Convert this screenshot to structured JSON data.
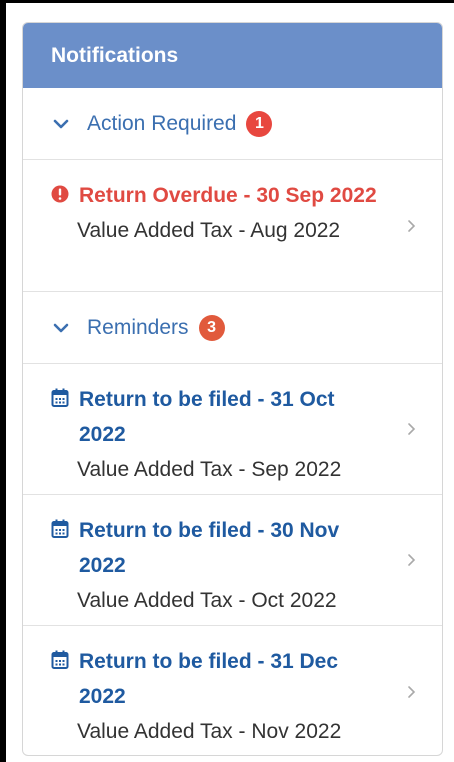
{
  "header": {
    "title": "Notifications"
  },
  "sections": {
    "action": {
      "label": "Action Required",
      "count": "1"
    },
    "reminders": {
      "label": "Reminders",
      "count": "3"
    }
  },
  "action_items": [
    {
      "title": "Return Overdue - 30 Sep 2022",
      "subtitle": "Value Added Tax - Aug 2022"
    }
  ],
  "reminder_items": [
    {
      "title": "Return to be filed - 31 Oct 2022",
      "subtitle": "Value Added Tax - Sep 2022"
    },
    {
      "title": "Return to be filed - 30 Nov 2022",
      "subtitle": "Value Added Tax - Oct 2022"
    },
    {
      "title": "Return to be filed - 31 Dec 2022",
      "subtitle": "Value Added Tax - Nov 2022"
    }
  ],
  "icons": {
    "section_toggle": "chevron-down-icon",
    "overdue": "alert-circle-icon",
    "reminder": "calendar-icon",
    "row_arrow": "chevron-right-icon"
  },
  "colors": {
    "header_bg": "#6b8fc9",
    "section_text": "#3b6fb0",
    "overdue_text": "#e04a42",
    "reminder_text": "#1f5aa0",
    "badge_red": "#e8473f"
  }
}
